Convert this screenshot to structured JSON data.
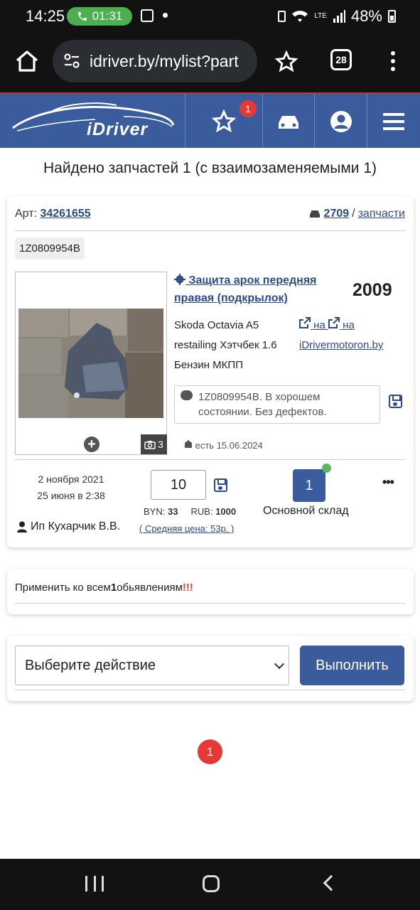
{
  "status_bar": {
    "time": "14:25",
    "call_timer": "01:31",
    "battery": "48%",
    "network": "LTE"
  },
  "browser": {
    "url": "idriver.by/mylist?part",
    "tab_count": "28"
  },
  "site": {
    "logo_text": "iDriver",
    "favorites_count": "1",
    "accent_color": "#3a5c9c",
    "badge_color": "#e53935"
  },
  "results": {
    "found_text": "Найдено запчастей 1 (с взаимозаменяемыми 1)"
  },
  "part": {
    "art_label": "Арт:",
    "art_number": "34261655",
    "car_id": "2709",
    "separator": "/",
    "parts_link": "запчасти",
    "code": "1Z0809954B",
    "title": "Защита арок передняя правая (подкрылок)",
    "year": "2009",
    "car_description": "Skoda Octavia A5 restailing Хэтчбек 1.6 Бензин МКПП",
    "ext_link1": "на",
    "ext_link2": "на",
    "ext_site": "iDrivermotoron.by",
    "comment": "1Z0809954B. В хорошем состоянии. Без дефектов.",
    "stock_date": "есть 15.06.2024",
    "photo_count": "3",
    "created_date": "2 ноября 2021",
    "updated_date": "25 июня в 2:38",
    "quantity": "10",
    "byn_label": "BYN:",
    "byn_value": "33",
    "rub_label": "RUB:",
    "rub_value": "1000",
    "avg_price": "( Средняя цена: 53р. )",
    "stock_number": "1",
    "warehouse": "Основной склад",
    "seller": "Ип Кухарчик В.В.",
    "more": "•••"
  },
  "bulk": {
    "apply_prefix": "Применить ко всем",
    "apply_count": "1",
    "apply_suffix": "обьявлениям",
    "apply_marks": "!!!"
  },
  "actions": {
    "select_value": "Выберите действие",
    "execute_label": "Выполнить"
  },
  "pagination": {
    "current": "1"
  }
}
